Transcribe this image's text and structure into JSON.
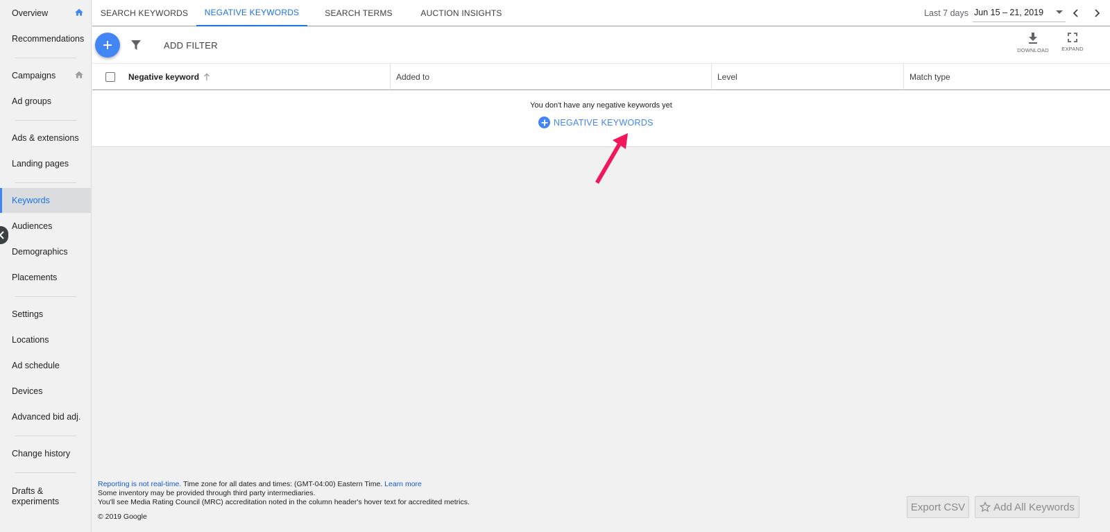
{
  "sidebar": {
    "items": [
      {
        "label": "Overview"
      },
      {
        "label": "Recommendations"
      },
      {
        "label": "Campaigns"
      },
      {
        "label": "Ad groups"
      },
      {
        "label": "Ads & extensions"
      },
      {
        "label": "Landing pages"
      },
      {
        "label": "Keywords"
      },
      {
        "label": "Audiences"
      },
      {
        "label": "Demographics"
      },
      {
        "label": "Placements"
      },
      {
        "label": "Settings"
      },
      {
        "label": "Locations"
      },
      {
        "label": "Ad schedule"
      },
      {
        "label": "Devices"
      },
      {
        "label": "Advanced bid adj."
      },
      {
        "label": "Change history"
      },
      {
        "label": "Drafts & experiments"
      }
    ],
    "active": "Keywords"
  },
  "tabs": [
    {
      "label": "SEARCH KEYWORDS"
    },
    {
      "label": "NEGATIVE KEYWORDS"
    },
    {
      "label": "SEARCH TERMS"
    },
    {
      "label": "AUCTION INSIGHTS"
    }
  ],
  "active_tab": "NEGATIVE KEYWORDS",
  "date": {
    "label": "Last 7 days",
    "range": "Jun 15 – 21, 2019"
  },
  "toolbar": {
    "add_filter": "ADD FILTER",
    "download": "DOWNLOAD",
    "expand": "EXPAND"
  },
  "table": {
    "columns": [
      "Negative keyword",
      "Added to",
      "Level",
      "Match type"
    ],
    "empty_message": "You don't have any negative keywords yet",
    "add_button": "NEGATIVE KEYWORDS"
  },
  "footer": {
    "reporting_link": "Reporting is not real-time.",
    "timezone": " Time zone for all dates and times: (GMT-04:00) Eastern Time. ",
    "learn_more": "Learn more",
    "line2": "Some inventory may be provided through third party intermediaries.",
    "line3": "You'll see Media Rating Council (MRC) accreditation noted in the column header's hover text for accredited metrics.",
    "copyright": "© 2019 Google"
  },
  "buttons": {
    "export_csv": "Export CSV",
    "add_all_keywords": "Add All Keywords"
  },
  "colors": {
    "accent": "#1a73e8",
    "fab": "#4285f4",
    "annotation_arrow": "#f0185a"
  }
}
